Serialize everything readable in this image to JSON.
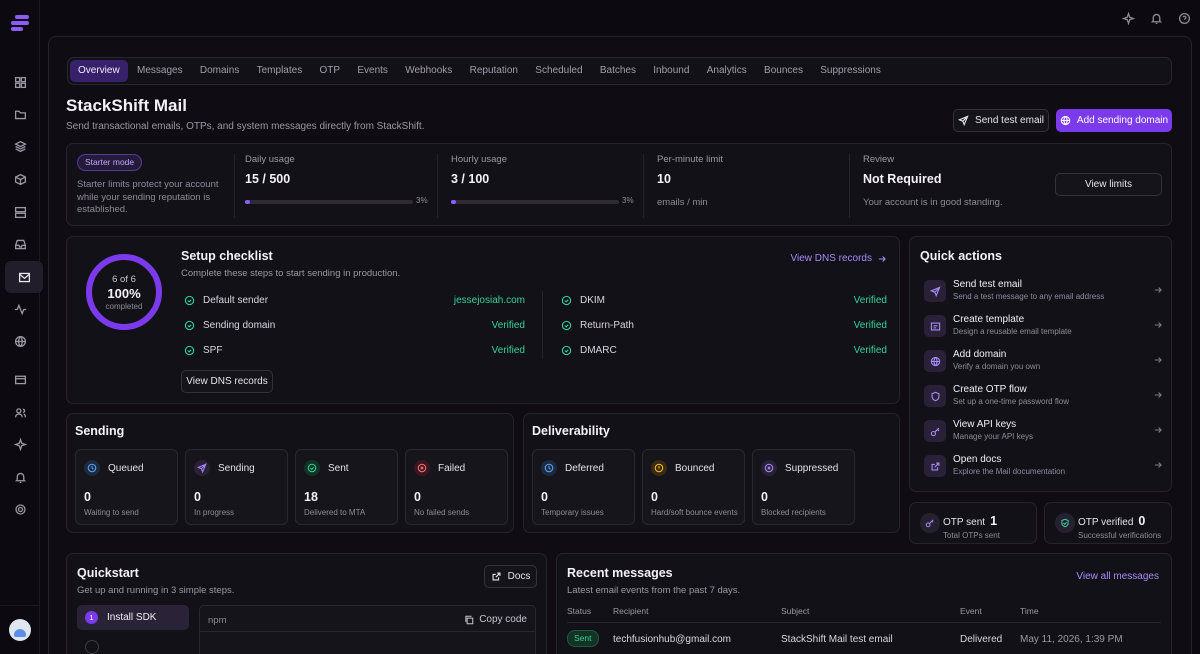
{
  "nav": {
    "tabs": [
      "Overview",
      "Messages",
      "Domains",
      "Templates",
      "OTP",
      "Events",
      "Webhooks",
      "Reputation",
      "Scheduled",
      "Batches",
      "Inbound",
      "Analytics",
      "Bounces",
      "Suppressions"
    ],
    "active_tab": "Overview"
  },
  "header": {
    "title": "StackShift Mail",
    "subtitle": "Send transactional emails, OTPs, and system messages directly from StackShift.",
    "send_test_label": "Send test email",
    "add_domain_label": "Add sending domain"
  },
  "usage": {
    "badge": "Starter mode",
    "description": "Starter limits protect your account while your sending reputation is established.",
    "daily_label": "Daily usage",
    "daily_value": "15 / 500",
    "daily_pct_label": "3%",
    "daily_fraction": 0.03,
    "hourly_label": "Hourly usage",
    "hourly_value": "3 / 100",
    "hourly_pct_label": "3%",
    "hourly_fraction": 0.03,
    "minute_label": "Per-minute limit",
    "minute_value": "10",
    "minute_unit": "emails / min",
    "review_label": "Review",
    "review_value": "Not Required",
    "review_note": "Your account is in good standing.",
    "view_limits_label": "View limits"
  },
  "checklist": {
    "count": "6 of 6",
    "percent": "100%",
    "completed_label": "completed",
    "progress_fraction": 1.0,
    "title": "Setup checklist",
    "subtitle": "Complete these steps to start sending in production.",
    "dns_link": "View DNS records",
    "dns_button": "View DNS records",
    "left": [
      {
        "name": "Default sender",
        "value": "jessejosiah.com"
      },
      {
        "name": "Sending domain",
        "value": "Verified"
      },
      {
        "name": "SPF",
        "value": "Verified"
      }
    ],
    "right": [
      {
        "name": "DKIM",
        "value": "Verified"
      },
      {
        "name": "Return-Path",
        "value": "Verified"
      },
      {
        "name": "DMARC",
        "value": "Verified"
      }
    ]
  },
  "quick_actions": {
    "title": "Quick actions",
    "items": [
      {
        "name": "Send test email",
        "desc": "Send a test message to any email address",
        "icon": "send-icon"
      },
      {
        "name": "Create template",
        "desc": "Design a reusable email template",
        "icon": "template-icon"
      },
      {
        "name": "Add domain",
        "desc": "Verify a domain you own",
        "icon": "globe-icon"
      },
      {
        "name": "Create OTP flow",
        "desc": "Set up a one-time password flow",
        "icon": "shield-icon"
      },
      {
        "name": "View API keys",
        "desc": "Manage your API keys",
        "icon": "key-icon"
      },
      {
        "name": "Open docs",
        "desc": "Explore the Mail documentation",
        "icon": "external-link-icon"
      }
    ]
  },
  "otp": {
    "sent_label": "OTP sent",
    "sent_value": "1",
    "sent_sub": "Total OTPs sent",
    "verified_label": "OTP verified",
    "verified_value": "0",
    "verified_sub": "Successful verifications"
  },
  "sending": {
    "title": "Sending",
    "stats": [
      {
        "label": "Queued",
        "value": "0",
        "sub": "Waiting to send"
      },
      {
        "label": "Sending",
        "value": "0",
        "sub": "In progress"
      },
      {
        "label": "Sent",
        "value": "18",
        "sub": "Delivered to MTA"
      },
      {
        "label": "Failed",
        "value": "0",
        "sub": "No failed sends"
      }
    ]
  },
  "deliverability": {
    "title": "Deliverability",
    "stats": [
      {
        "label": "Deferred",
        "value": "0",
        "sub": "Temporary issues"
      },
      {
        "label": "Bounced",
        "value": "0",
        "sub": "Hard/soft bounce events"
      },
      {
        "label": "Suppressed",
        "value": "0",
        "sub": "Blocked recipients"
      }
    ]
  },
  "quickstart": {
    "title": "Quickstart",
    "subtitle": "Get up and running in 3 simple steps.",
    "docs_label": "Docs",
    "step_num": "1",
    "step_label": "Install SDK",
    "code_lang": "npm",
    "copy_label": "Copy code"
  },
  "recent": {
    "title": "Recent messages",
    "subtitle": "Latest email events from the past 7 days.",
    "view_all": "View all messages",
    "headers": {
      "status": "Status",
      "recipient": "Recipient",
      "subject": "Subject",
      "event": "Event",
      "time": "Time"
    },
    "rows": [
      {
        "status": "Sent",
        "recipient": "techfusionhub@gmail.com",
        "subject": "StackShift Mail test email",
        "event": "Delivered",
        "time": "May 11, 2026, 1:39 PM"
      }
    ]
  },
  "colors": {
    "accent": "#7c3aed",
    "success": "#34d399"
  }
}
